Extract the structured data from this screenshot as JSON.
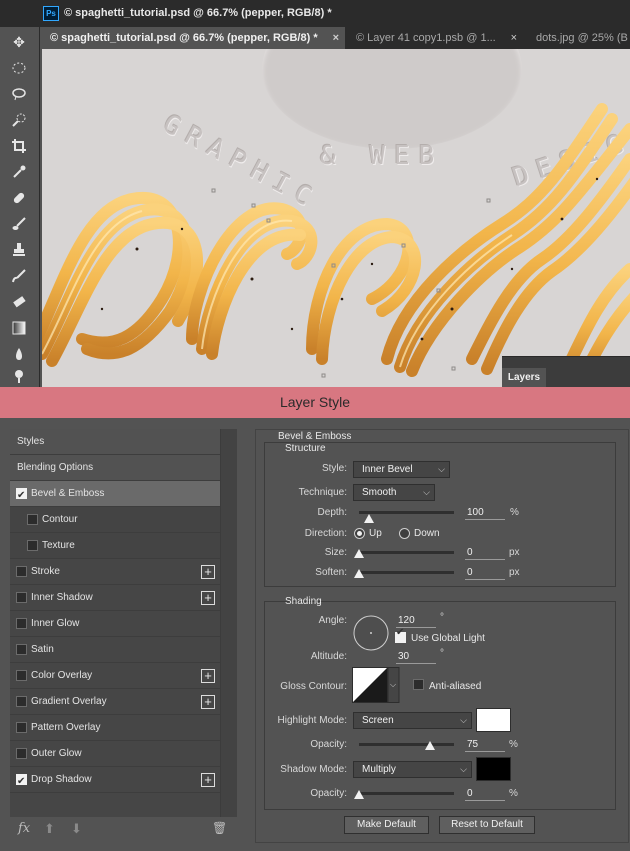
{
  "window": {
    "ps_logo": "Ps",
    "title": "© spaghetti_tutorial.psd @ 66.7% (pepper, RGB/8) *"
  },
  "tabs": [
    {
      "label": "© spaghetti_tutorial.psd @ 66.7% (pepper, RGB/8) *",
      "close": "×"
    },
    {
      "label": "© Layer 41 copy1.psb @ 1...",
      "close": "×"
    },
    {
      "label": "dots.jpg @ 25% (B",
      "close": ""
    }
  ],
  "toolbar": {
    "icons": [
      "move-icon",
      "marquee-icon",
      "lasso-icon",
      "quick-select-icon",
      "crop-icon",
      "eyedropper-icon",
      "healing-brush-icon",
      "brush-icon",
      "clone-stamp-icon",
      "history-brush-icon",
      "eraser-icon",
      "gradient-icon",
      "blur-icon",
      "dodge-icon"
    ]
  },
  "canvas": {
    "text_graphic": "GRAPHIC",
    "text_and": "&",
    "text_web": "WEB",
    "text_design": "DESIGN",
    "background_color": "#d8d5d4",
    "noodle_color": "#f2b54a"
  },
  "layers_panel": {
    "tab": "Layers"
  },
  "dialog": {
    "title": "Layer Style",
    "title_bar_color": "#d87781",
    "styles_list": [
      {
        "label": "Styles",
        "checkbox": null,
        "plus": false,
        "kind": "header"
      },
      {
        "label": "Blending Options",
        "checkbox": null,
        "plus": false,
        "kind": "header"
      },
      {
        "label": "Bevel & Emboss",
        "checkbox": true,
        "plus": false,
        "kind": "selected"
      },
      {
        "label": "Contour",
        "checkbox": false,
        "plus": false,
        "kind": "sub"
      },
      {
        "label": "Texture",
        "checkbox": false,
        "plus": false,
        "kind": "sub"
      },
      {
        "label": "Stroke",
        "checkbox": false,
        "plus": true,
        "kind": "item"
      },
      {
        "label": "Inner Shadow",
        "checkbox": false,
        "plus": true,
        "kind": "item"
      },
      {
        "label": "Inner Glow",
        "checkbox": false,
        "plus": false,
        "kind": "item"
      },
      {
        "label": "Satin",
        "checkbox": false,
        "plus": false,
        "kind": "item"
      },
      {
        "label": "Color Overlay",
        "checkbox": false,
        "plus": true,
        "kind": "item"
      },
      {
        "label": "Gradient Overlay",
        "checkbox": false,
        "plus": true,
        "kind": "item"
      },
      {
        "label": "Pattern Overlay",
        "checkbox": false,
        "plus": false,
        "kind": "item"
      },
      {
        "label": "Outer Glow",
        "checkbox": false,
        "plus": false,
        "kind": "item"
      },
      {
        "label": "Drop Shadow",
        "checkbox": true,
        "plus": true,
        "kind": "item"
      }
    ],
    "footer": {
      "fx": "fx",
      "up": "⬆",
      "down": "⬇",
      "trash": "🗑"
    },
    "bevel_emboss": {
      "section_title": "Bevel & Emboss",
      "structure_title": "Structure",
      "style_label": "Style:",
      "style_value": "Inner Bevel",
      "technique_label": "Technique:",
      "technique_value": "Smooth",
      "depth_label": "Depth:",
      "depth_value": "100",
      "depth_unit": "%",
      "depth_fraction": 0.1,
      "direction_label": "Direction:",
      "direction_up": "Up",
      "direction_down": "Down",
      "direction_selected": "Up",
      "size_label": "Size:",
      "size_value": "0",
      "size_unit": "px",
      "size_fraction": 0,
      "soften_label": "Soften:",
      "soften_value": "0",
      "soften_unit": "px",
      "soften_fraction": 0
    },
    "shading": {
      "section_title": "Shading",
      "angle_label": "Angle:",
      "angle_value": "120",
      "angle_unit": "°",
      "use_global_light_label": "Use Global Light",
      "use_global_light": true,
      "altitude_label": "Altitude:",
      "altitude_value": "30",
      "altitude_unit": "°",
      "gloss_contour_label": "Gloss Contour:",
      "anti_aliased_label": "Anti-aliased",
      "anti_aliased": false,
      "highlight_mode_label": "Highlight Mode:",
      "highlight_mode_value": "Screen",
      "highlight_color": "#ffffff",
      "highlight_opacity_label": "Opacity:",
      "highlight_opacity_value": "75",
      "highlight_opacity_unit": "%",
      "highlight_opacity_fraction": 0.75,
      "shadow_mode_label": "Shadow Mode:",
      "shadow_mode_value": "Multiply",
      "shadow_color": "#000000",
      "shadow_opacity_label": "Opacity:",
      "shadow_opacity_value": "0",
      "shadow_opacity_unit": "%",
      "shadow_opacity_fraction": 0
    },
    "buttons": {
      "make_default": "Make Default",
      "reset_to_default": "Reset to Default"
    }
  }
}
